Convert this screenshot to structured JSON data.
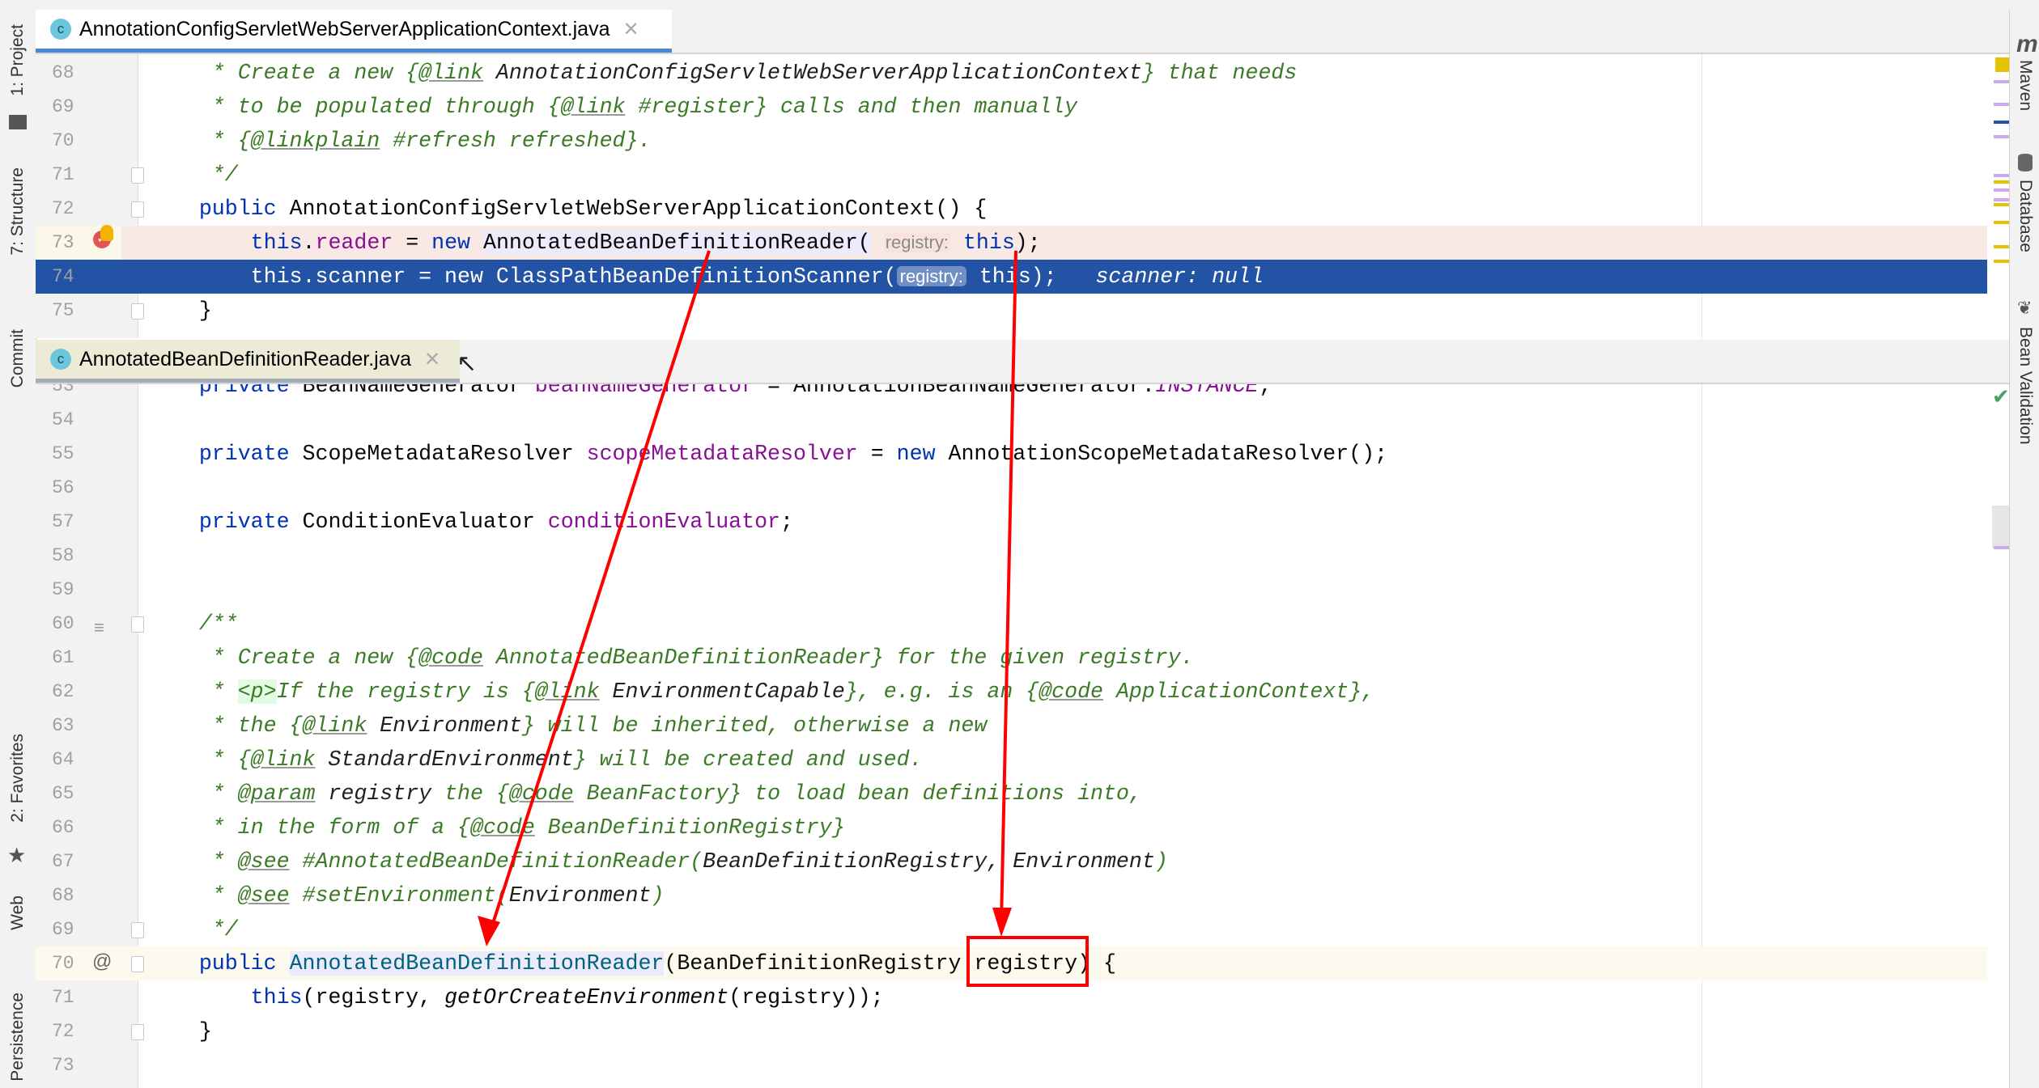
{
  "left_toolwindows": [
    "1: Project",
    "7: Structure",
    "Commit",
    "2: Favorites",
    "Web",
    "Persistence"
  ],
  "right_toolwindows": [
    "Maven",
    "Database",
    "Bean Validation"
  ],
  "tabs_top": {
    "label": "AnnotationConfigServletWebServerApplicationContext.java",
    "icon": "c-class-icon",
    "active": true
  },
  "tabs_bottom": {
    "label": "AnnotatedBeanDefinitionReader.java",
    "icon": "c-class-icon",
    "active": true
  },
  "colors": {
    "keyword": "#0033b3",
    "field": "#871094",
    "comment": "#3b7a26",
    "execution_line": "#2353a5",
    "breakpoint_line": "#f9e9e5",
    "annotation": "#ff0000"
  },
  "editor1": {
    "lines": [
      {
        "num": "68",
        "tokens": [
          [
            "     * Create a new {",
            "cm"
          ],
          [
            "@link",
            "tag"
          ],
          [
            " AnnotationConfigServletWebServerApplicationContext",
            "ref"
          ],
          [
            "} that needs",
            "cm"
          ]
        ]
      },
      {
        "num": "69",
        "tokens": [
          [
            "     * to be populated through {",
            "cm"
          ],
          [
            "@link",
            "tag"
          ],
          [
            " #register} calls and then manually",
            "cm"
          ]
        ]
      },
      {
        "num": "70",
        "tokens": [
          [
            "     * {",
            "cm"
          ],
          [
            "@linkplain",
            "tag"
          ],
          [
            " #refresh refreshed}.",
            "cm"
          ]
        ]
      },
      {
        "num": "71",
        "tokens": [
          [
            "     */",
            "cm"
          ]
        ]
      },
      {
        "num": "72",
        "tokens": [
          [
            "    ",
            ""
          ],
          [
            "public",
            "kw"
          ],
          [
            " AnnotationConfigServletWebServerApplicationContext() {",
            ""
          ]
        ]
      },
      {
        "num": "73",
        "state": "breakpoint",
        "tokens": [
          [
            "        ",
            ""
          ],
          [
            "this",
            "kw"
          ],
          [
            ".",
            ""
          ],
          [
            "reader",
            "fld"
          ],
          [
            " = ",
            ""
          ],
          [
            "new",
            "kw"
          ],
          [
            " ",
            ""
          ],
          [
            "AnnotatedBeanDefinitionReader(",
            "hl"
          ],
          [
            " ",
            ""
          ],
          [
            "registry:",
            "hint"
          ],
          [
            " ",
            ""
          ],
          [
            "this",
            "kw"
          ],
          [
            ");",
            ""
          ]
        ]
      },
      {
        "num": "74",
        "state": "current",
        "tokens": [
          [
            "        this.scanner = new ClassPathBeanDefinitionScanner(",
            ""
          ],
          [
            "registry:",
            "hint-sel"
          ],
          [
            " this);",
            ""
          ],
          [
            "   scanner: null",
            "dbg"
          ]
        ]
      },
      {
        "num": "75",
        "tokens": [
          [
            "    }",
            ""
          ]
        ]
      }
    ]
  },
  "editor2": {
    "lines": [
      {
        "num": "53",
        "tokens": [
          [
            "    ",
            ""
          ],
          [
            "private",
            "kw"
          ],
          [
            " BeanNameGenerator ",
            ""
          ],
          [
            "beanNameGenerator",
            "fld"
          ],
          [
            " = AnnotationBeanNameGenerator.",
            ""
          ],
          [
            "INSTANCE",
            "stat"
          ],
          [
            ";",
            ""
          ]
        ]
      },
      {
        "num": "54",
        "tokens": []
      },
      {
        "num": "55",
        "tokens": [
          [
            "    ",
            ""
          ],
          [
            "private",
            "kw"
          ],
          [
            " ScopeMetadataResolver ",
            ""
          ],
          [
            "scopeMetadataResolver",
            "fld"
          ],
          [
            " = ",
            ""
          ],
          [
            "new",
            "kw"
          ],
          [
            " AnnotationScopeMetadataResolver();",
            ""
          ]
        ]
      },
      {
        "num": "56",
        "tokens": []
      },
      {
        "num": "57",
        "tokens": [
          [
            "    ",
            ""
          ],
          [
            "private",
            "kw"
          ],
          [
            " ConditionEvaluator ",
            ""
          ],
          [
            "conditionEvaluator",
            "fld"
          ],
          [
            ";",
            ""
          ]
        ]
      },
      {
        "num": "58",
        "tokens": []
      },
      {
        "num": "59",
        "tokens": []
      },
      {
        "num": "60",
        "tokens": [
          [
            "    /**",
            "cm"
          ]
        ]
      },
      {
        "num": "61",
        "tokens": [
          [
            "     * Create a new {",
            "cm"
          ],
          [
            "@code",
            "tag"
          ],
          [
            " AnnotatedBeanDefinitionReader} for the given registry.",
            "cm"
          ]
        ]
      },
      {
        "num": "62",
        "tokens": [
          [
            "     * ",
            "cm"
          ],
          [
            "<p>",
            "html"
          ],
          [
            "If the registry is {",
            "cm"
          ],
          [
            "@link",
            "tag"
          ],
          [
            " EnvironmentCapable",
            "ref"
          ],
          [
            "}, e.g. is an {",
            "cm"
          ],
          [
            "@code",
            "tag"
          ],
          [
            " ApplicationContext},",
            "cm"
          ]
        ]
      },
      {
        "num": "63",
        "tokens": [
          [
            "     * the {",
            "cm"
          ],
          [
            "@link",
            "tag"
          ],
          [
            " Environment",
            "ref"
          ],
          [
            "} will be inherited, otherwise a new",
            "cm"
          ]
        ]
      },
      {
        "num": "64",
        "tokens": [
          [
            "     * {",
            "cm"
          ],
          [
            "@link",
            "tag"
          ],
          [
            " StandardEnvironment",
            "ref"
          ],
          [
            "} will be created and used.",
            "cm"
          ]
        ]
      },
      {
        "num": "65",
        "tokens": [
          [
            "     * ",
            "cm"
          ],
          [
            "@param",
            "tag"
          ],
          [
            " registry",
            "ref"
          ],
          [
            " the {",
            "cm"
          ],
          [
            "@code",
            "tag"
          ],
          [
            " BeanFactory} to load bean definitions into,",
            "cm"
          ]
        ]
      },
      {
        "num": "66",
        "tokens": [
          [
            "     * in the form of a {",
            "cm"
          ],
          [
            "@code",
            "tag"
          ],
          [
            " BeanDefinitionRegistry}",
            "cm"
          ]
        ]
      },
      {
        "num": "67",
        "tokens": [
          [
            "     * ",
            "cm"
          ],
          [
            "@see",
            "tag"
          ],
          [
            " #AnnotatedBeanDefinitionReader(",
            "cm"
          ],
          [
            "BeanDefinitionRegistry, Environment",
            "ref"
          ],
          [
            ")",
            "cm"
          ]
        ]
      },
      {
        "num": "68",
        "tokens": [
          [
            "     * ",
            "cm"
          ],
          [
            "@see",
            "tag"
          ],
          [
            " #setEnvironment(",
            "cm"
          ],
          [
            "Environment",
            "ref"
          ],
          [
            ")",
            "cm"
          ]
        ]
      },
      {
        "num": "69",
        "tokens": [
          [
            "     */",
            "cm"
          ]
        ]
      },
      {
        "num": "70",
        "state": "caret",
        "tokens": [
          [
            "    ",
            ""
          ],
          [
            "public",
            "kw"
          ],
          [
            " ",
            ""
          ],
          [
            "AnnotatedBeanDefinitionReader",
            "decl"
          ],
          [
            "(BeanDefinitionRegistry registry) {",
            ""
          ]
        ]
      },
      {
        "num": "71",
        "tokens": [
          [
            "        ",
            ""
          ],
          [
            "this",
            "kw"
          ],
          [
            "(registry, ",
            ""
          ],
          [
            "getOrCreateEnvironment",
            "ital"
          ],
          [
            "(registry));",
            ""
          ]
        ]
      },
      {
        "num": "72",
        "tokens": [
          [
            "    }",
            ""
          ]
        ]
      },
      {
        "num": "73",
        "tokens": []
      }
    ]
  }
}
